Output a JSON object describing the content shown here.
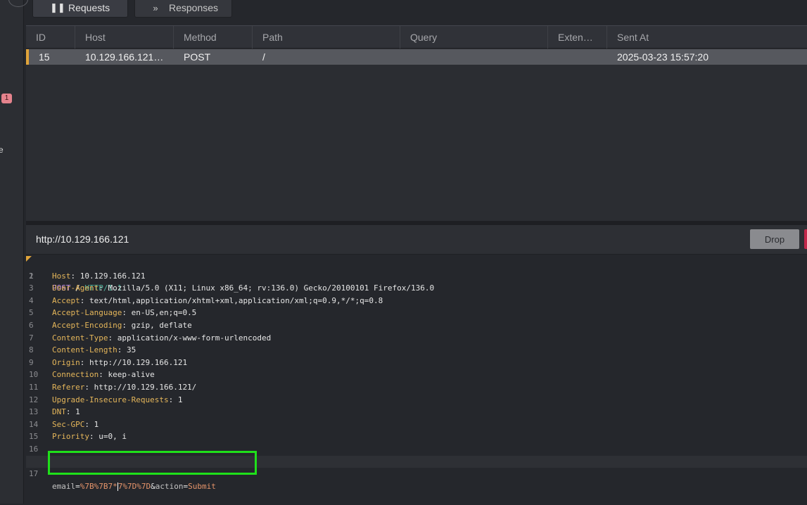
{
  "sidebar": {
    "badge_count": "1",
    "cut_label": "e"
  },
  "tabs": [
    {
      "label": "Requests",
      "icon": "pause-icon"
    },
    {
      "label": "Responses",
      "icon": "double-chevron-right-icon"
    }
  ],
  "table": {
    "columns": [
      "ID",
      "Host",
      "Method",
      "Path",
      "Query",
      "Exten…",
      "Sent At"
    ],
    "rows": [
      {
        "id": "15",
        "host": "10.129.166.121…",
        "method": "POST",
        "path": "/",
        "query": "",
        "ext": "",
        "sent_at": "2025-03-23 15:57:20"
      }
    ]
  },
  "request": {
    "url": "http://10.129.166.121",
    "drop_label": "Drop",
    "request_line": {
      "method": "POST",
      "path": "/",
      "version": "HTTP/1.1"
    },
    "headers": [
      {
        "name": "Host",
        "value": "10.129.166.121"
      },
      {
        "name": "User-Agent",
        "value": "Mozilla/5.0 (X11; Linux x86_64; rv:136.0) Gecko/20100101 Firefox/136.0"
      },
      {
        "name": "Accept",
        "value": "text/html,application/xhtml+xml,application/xml;q=0.9,*/*;q=0.8"
      },
      {
        "name": "Accept-Language",
        "value": "en-US,en;q=0.5"
      },
      {
        "name": "Accept-Encoding",
        "value": "gzip, deflate"
      },
      {
        "name": "Content-Type",
        "value": "application/x-www-form-urlencoded"
      },
      {
        "name": "Content-Length",
        "value": "35"
      },
      {
        "name": "Origin",
        "value": "http://10.129.166.121"
      },
      {
        "name": "Connection",
        "value": "keep-alive"
      },
      {
        "name": "Referer",
        "value": "http://10.129.166.121/"
      },
      {
        "name": "Upgrade-Insecure-Requests",
        "value": "1"
      },
      {
        "name": "DNT",
        "value": "1"
      },
      {
        "name": "Sec-GPC",
        "value": "1"
      },
      {
        "name": "Priority",
        "value": "u=0, i"
      }
    ],
    "body": {
      "key1": "email",
      "val1_before_cursor": "%7B%7B7*",
      "val1_after_cursor": "7%7D%7D",
      "key2": "action",
      "val2": "Submit"
    },
    "line_numbers": [
      "1",
      "2",
      "3",
      "4",
      "5",
      "6",
      "7",
      "8",
      "9",
      "10",
      "11",
      "12",
      "13",
      "14",
      "15",
      "16",
      "17"
    ]
  },
  "colors": {
    "accent_orange": "#e0a43a",
    "highlight_green": "#1fe01a",
    "forward_red": "#c2274a"
  }
}
